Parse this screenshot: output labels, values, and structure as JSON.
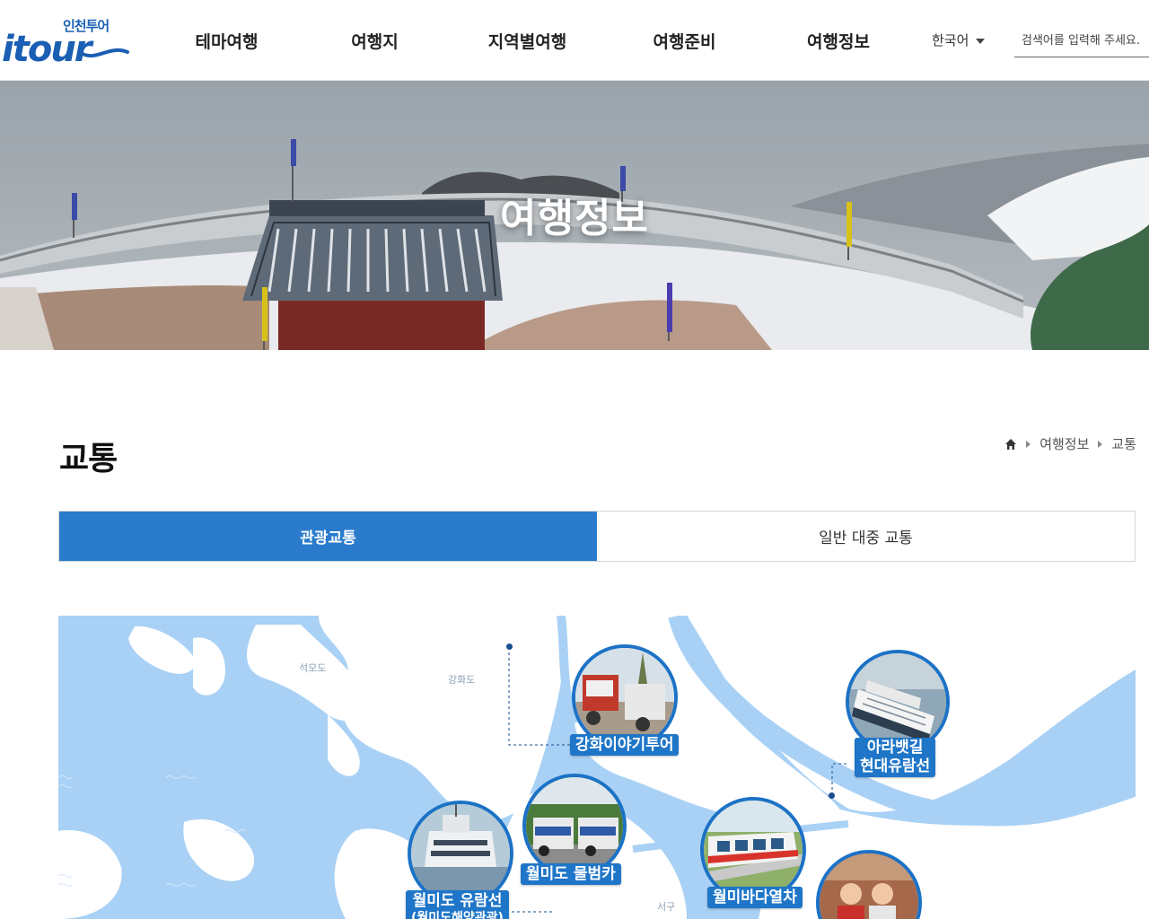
{
  "header": {
    "logo_ko": "인천투어",
    "logo_en": "itour",
    "nav": [
      "테마여행",
      "여행지",
      "지역별여행",
      "여행준비",
      "여행정보"
    ],
    "language": "한국어",
    "search_placeholder": "검색어를 입력해 주세요."
  },
  "hero": {
    "title": "여행정보"
  },
  "page": {
    "title": "교통",
    "breadcrumb": [
      "여행정보",
      "교통"
    ]
  },
  "tabs": [
    {
      "label": "관광교통",
      "active": true
    },
    {
      "label": "일반 대중 교통",
      "active": false
    }
  ],
  "map": {
    "place_labels": [
      "석모도",
      "강화도",
      "서구"
    ],
    "spots": [
      {
        "label": "강화이야기투어",
        "icon": "tour-bus-photo"
      },
      {
        "label": "아라뱃길\n현대유람선",
        "line1": "아라뱃길",
        "line2": "현대유람선",
        "icon": "cruise-ship-photo"
      },
      {
        "label": "월미도 물범카",
        "icon": "tram-car-photo"
      },
      {
        "label": "월미바다열차",
        "icon": "monorail-train-photo"
      },
      {
        "label": "월미도 유람선",
        "sub": "(월미도해양관광)",
        "icon": "ferry-photo"
      },
      {
        "label": "",
        "icon": "people-photo"
      }
    ]
  },
  "colors": {
    "accent": "#2a7bcc",
    "map_sea": "#a9d1f5",
    "map_land": "#ffffff",
    "logo": "#1a5fb4"
  }
}
